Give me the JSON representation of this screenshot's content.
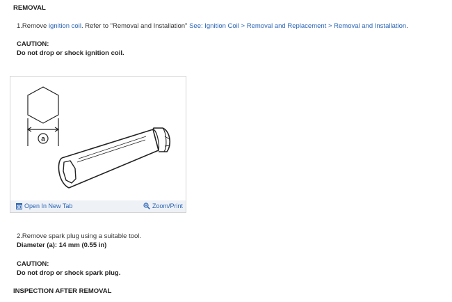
{
  "sections": {
    "removal_heading": "REMOVAL",
    "inspection_heading": "INSPECTION AFTER REMOVAL"
  },
  "step1": {
    "prefix": "1.Remove ",
    "link_ignition_coil": "ignition coil",
    "middle": ". Refer to \"Removal and Installation\" ",
    "see_link": "See: Ignition Coil > Removal and Replacement > Removal and Installation",
    "suffix": "."
  },
  "caution1": {
    "label": "CAUTION:",
    "text": "Do not drop or shock ignition coil."
  },
  "figure": {
    "callout": "a",
    "open_new_tab": "Open In New Tab",
    "zoom_print": "Zoom/Print"
  },
  "step2": {
    "text": "2.Remove spark plug using a suitable tool.",
    "diameter": "Diameter (a): 14 mm (0.55 in)"
  },
  "caution2": {
    "label": "CAUTION:",
    "text": "Do not drop or shock spark plug."
  },
  "icons": {
    "open_tab": "open-new-tab-icon",
    "zoom": "magnifier-icon"
  },
  "colors": {
    "link": "#2a64b5",
    "footer_bg": "#eef1f5"
  }
}
